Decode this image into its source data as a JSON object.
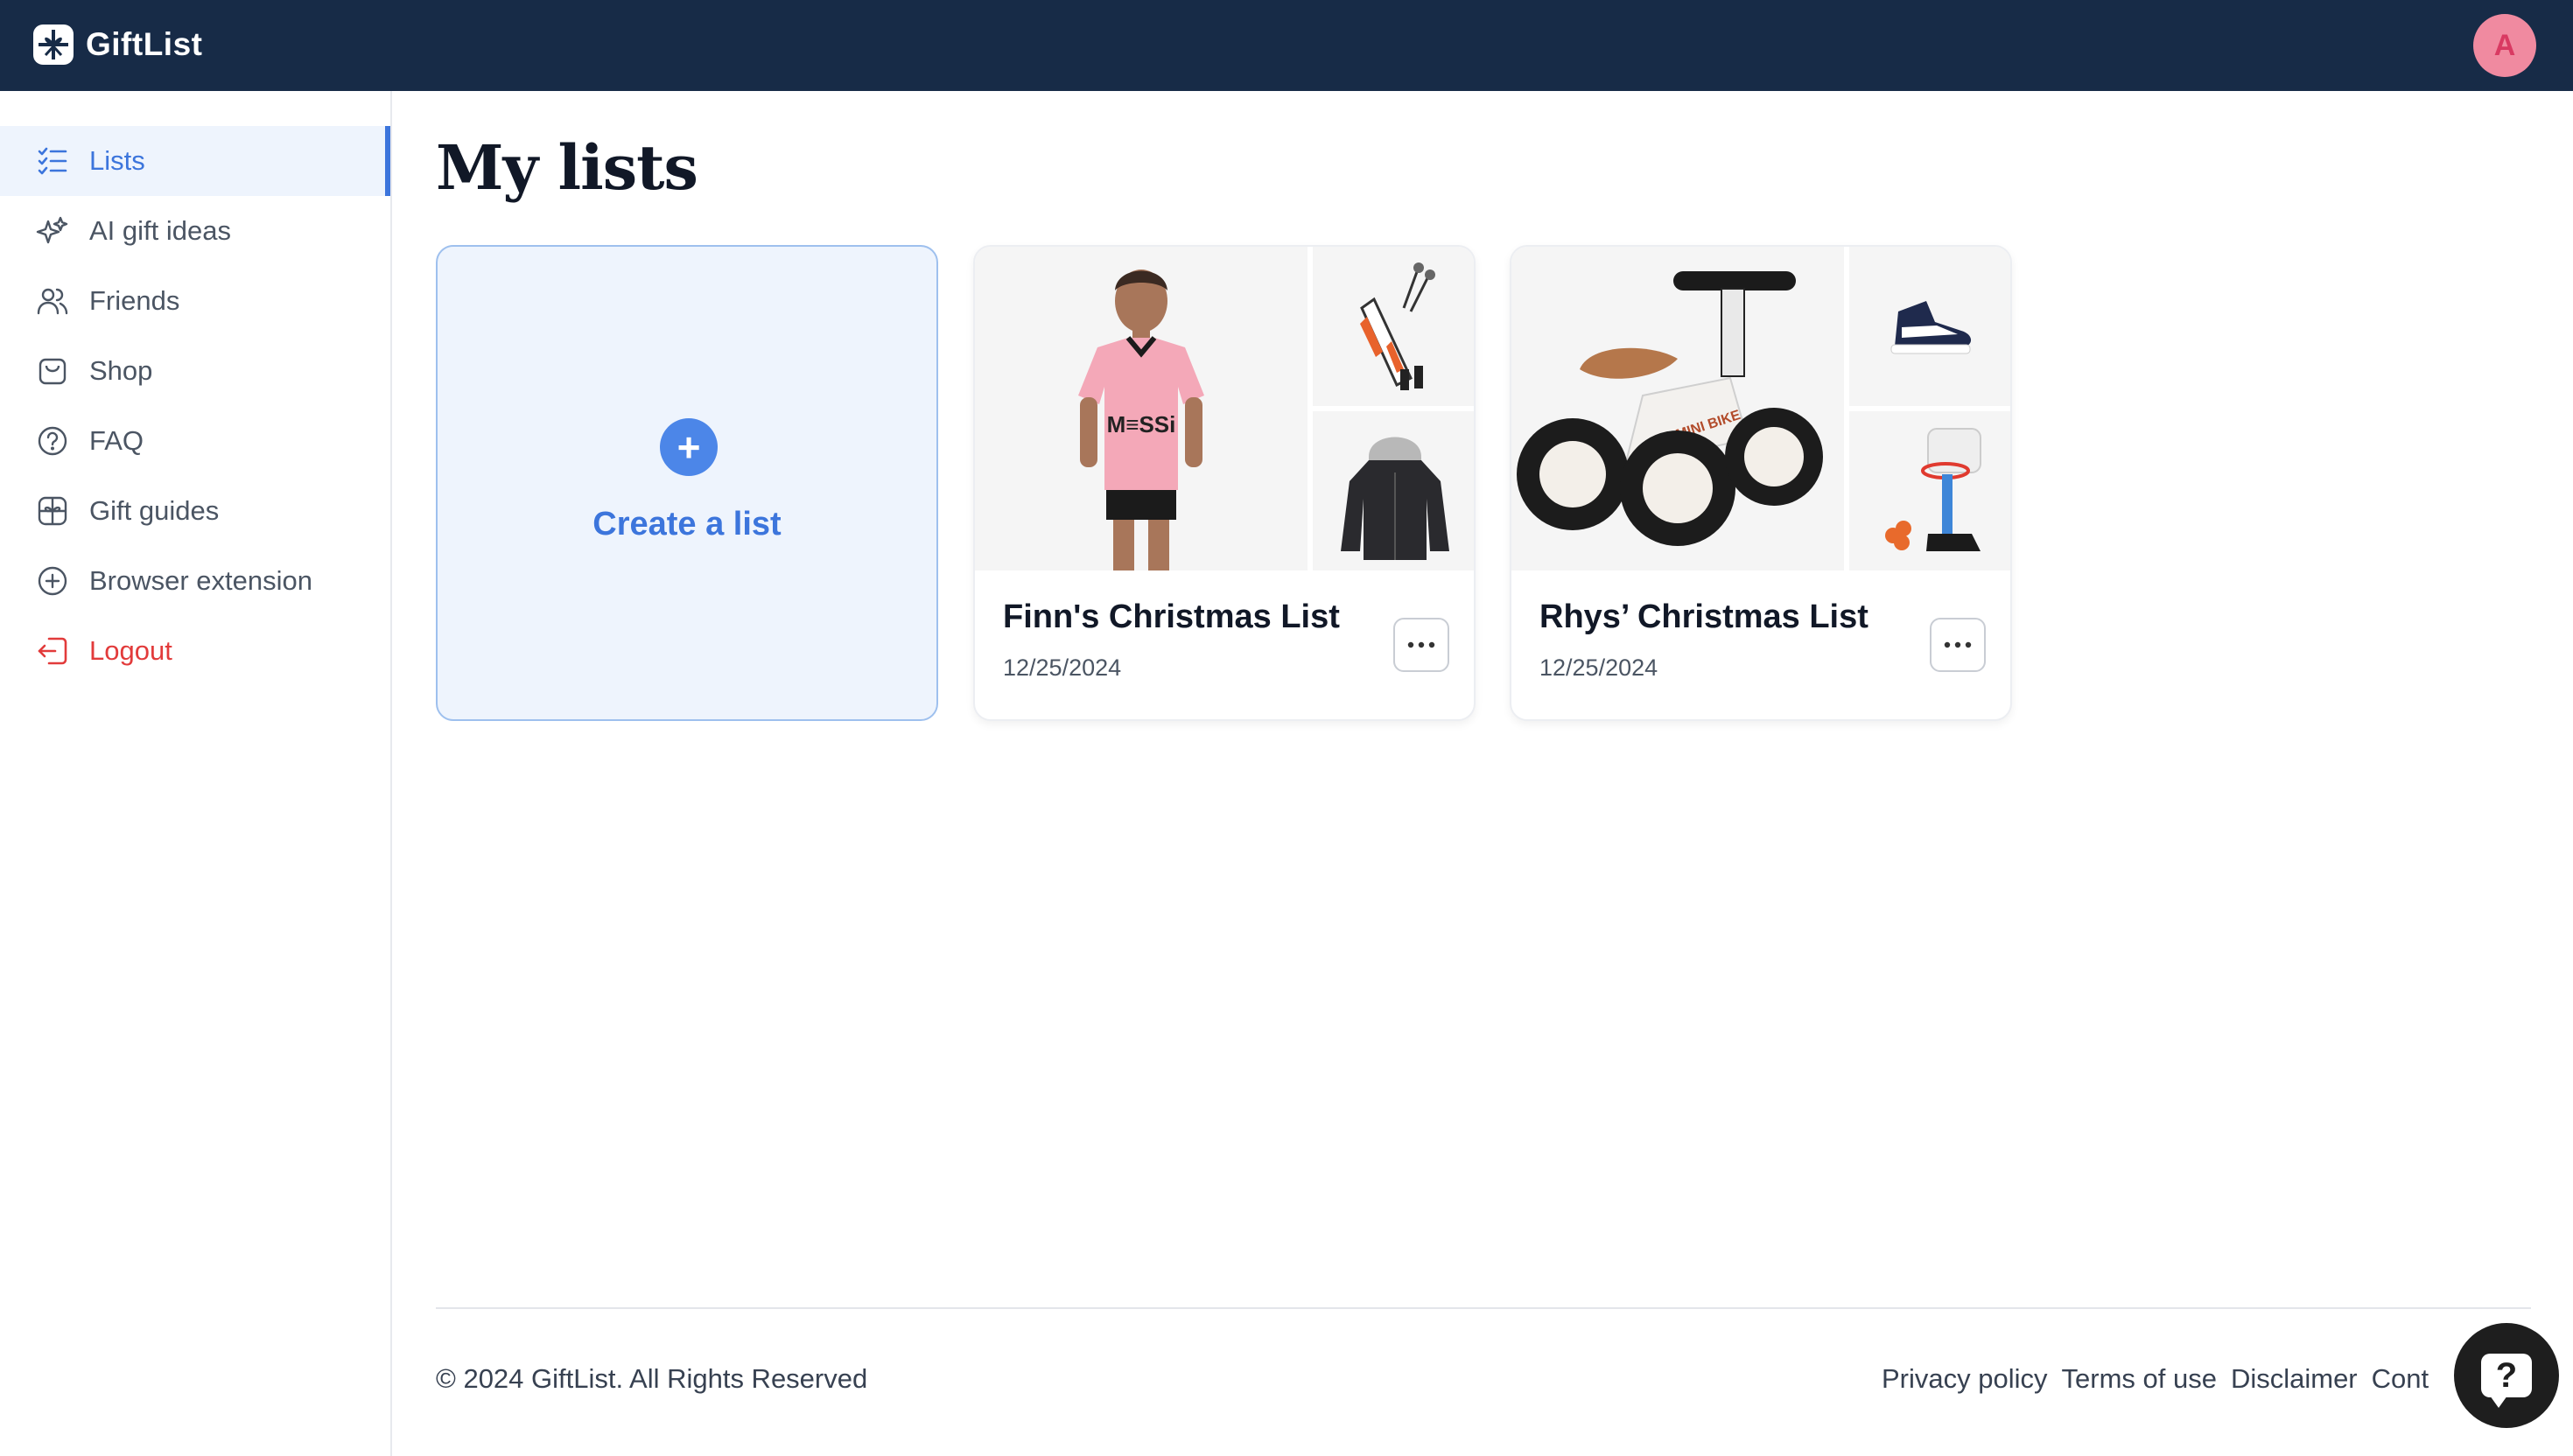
{
  "app": {
    "name": "GiftList",
    "avatar_initial": "A"
  },
  "sidebar": {
    "items": [
      {
        "label": "Lists",
        "icon": "list-check-icon",
        "active": true
      },
      {
        "label": "AI gift ideas",
        "icon": "sparkles-icon"
      },
      {
        "label": "Friends",
        "icon": "users-icon"
      },
      {
        "label": "Shop",
        "icon": "shopping-bag-icon"
      },
      {
        "label": "FAQ",
        "icon": "question-circle-icon"
      },
      {
        "label": "Gift guides",
        "icon": "gift-box-icon"
      },
      {
        "label": "Browser extension",
        "icon": "plus-circle-icon"
      },
      {
        "label": "Logout",
        "icon": "logout-icon"
      }
    ]
  },
  "main": {
    "title": "My lists",
    "create_label": "Create a list",
    "create_plus": "+",
    "lists": [
      {
        "name": "Finn's Christmas List",
        "date": "12/25/2024",
        "images": [
          "pink-jersey-image",
          "golf-bag-image",
          "hooded-jacket-image"
        ]
      },
      {
        "name": "Rhys’ Christmas List",
        "date": "12/25/2024",
        "images": [
          "balance-bike-image",
          "sneaker-image",
          "basketball-hoop-image"
        ]
      }
    ]
  },
  "footer": {
    "copyright": "© 2024 GiftList. All Rights Reserved",
    "links": [
      "Privacy policy",
      "Terms of use",
      "Disclaimer",
      "Cont"
    ]
  },
  "help": {
    "symbol": "?"
  },
  "colors": {
    "topbar": "#172b47",
    "accent": "#3c75dc",
    "danger": "#e23b3b",
    "create_bg": "#eef4fd"
  }
}
